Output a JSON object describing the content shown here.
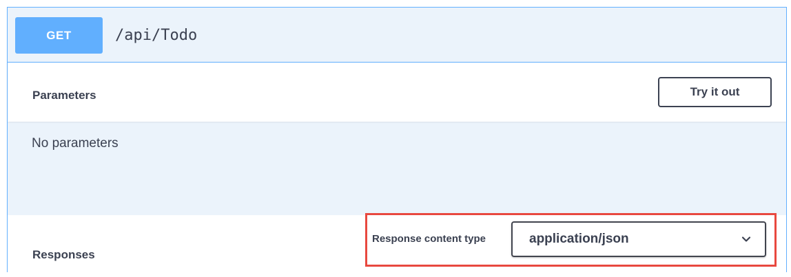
{
  "operation": {
    "method": "GET",
    "path": "/api/Todo"
  },
  "parameters": {
    "title": "Parameters",
    "try_button_label": "Try it out",
    "empty_text": "No parameters"
  },
  "responses": {
    "title": "Responses",
    "content_type_label": "Response content type",
    "content_type_value": "application/json",
    "dropdown_icon": "chevron-down-icon"
  },
  "colors": {
    "method_get": "#61affe",
    "block_background": "#ebf3fb",
    "text": "#3b4151",
    "highlight": "#e8483f"
  }
}
